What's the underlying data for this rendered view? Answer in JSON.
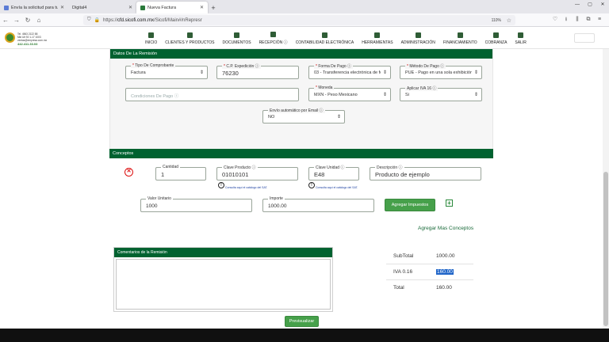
{
  "browser": {
    "tabs": [
      {
        "title": "Envía la solicitud para tu Certif...",
        "active": false
      },
      {
        "title": "Digital4",
        "active": false
      },
      {
        "title": "Nueva Factura",
        "active": true
      }
    ],
    "url_prefix": "https://",
    "url_domain": "cfd.sicofi.com.mx",
    "url_path": "/Sicofi/Main#/nRepresr",
    "zoom": "110%"
  },
  "nav": {
    "items": [
      {
        "label": "INICIO",
        "icon": "home-icon"
      },
      {
        "label": "CLIENTES Y PRODUCTOS",
        "icon": "users-icon"
      },
      {
        "label": "DOCUMENTOS",
        "icon": "folder-icon"
      },
      {
        "label": "RECEPCIÓN ⓘ",
        "icon": "inbox-icon"
      },
      {
        "label": "CONTABILIDAD ELECTRÓNICA",
        "icon": "chart-icon"
      },
      {
        "label": "HERRAMIENTAS",
        "icon": "tools-icon"
      },
      {
        "label": "ADMINISTRACIÓN",
        "icon": "admin-icon"
      },
      {
        "label": "FINANCIAMIENTO",
        "icon": "money-icon"
      },
      {
        "label": "COBRANZA",
        "icon": "cash-icon"
      },
      {
        "label": "SALIR",
        "icon": "logout-icon"
      }
    ],
    "logo_lines": [
      "Tel. 4563 2122 88",
      "Mkt Ult 92 1-17 1003",
      "ventas@empresa.com.mx"
    ],
    "logo_phone": "442.411.33.03"
  },
  "remision": {
    "header": "Datos De La Remisión",
    "tipo_comprobante": {
      "label": "Tipo De Comprobante",
      "value": "Factura"
    },
    "cp_expedicion": {
      "label": "C.P. Expedición ⓘ",
      "value": "76230"
    },
    "forma_pago": {
      "label": "Forma De Pago ⓘ",
      "value": "03 - Transferencia electrónica de fo"
    },
    "metodo_pago": {
      "label": "Método De Pago ⓘ",
      "value": "PUE - Pago en una sola exhibición"
    },
    "condiciones_pago": {
      "placeholder": "Condiciones De Pago ⓘ"
    },
    "moneda": {
      "label": "Moneda",
      "value": "MXN - Peso Mexicano"
    },
    "aplicar_iva": {
      "label": "Aplicar IVA 16 ⓘ",
      "value": "Si"
    },
    "envio_email": {
      "label": "Envío automático por Email ⓘ",
      "value": "NO"
    }
  },
  "conceptos": {
    "header": "Conceptos",
    "cantidad": {
      "label": "Cantidad",
      "value": "1"
    },
    "clave_producto": {
      "label": "Clave Producto ⓘ",
      "value": "01010101"
    },
    "clave_unidad": {
      "label": "Clave Unidad ⓘ",
      "value": "E48"
    },
    "descripcion": {
      "label": "Descripción ⓘ",
      "value": "Producto de ejemplo"
    },
    "valor_unitario": {
      "label": "Valor Unitario",
      "value": "1000"
    },
    "importe": {
      "label": "Importe",
      "value": "1000.00"
    },
    "catalog_note": "Consulta aquí el catálogo del SAT.",
    "agregar_impuestos": "Agregar Impuestos",
    "agregar_mas": "Agregar Mas Conceptos"
  },
  "comentarios": {
    "header": "Comentarios de la Remisión"
  },
  "totales": {
    "subtotal_label": "SubTotal",
    "subtotal_value": "1000.00",
    "iva_label": "IVA 0.16",
    "iva_value": "160.00",
    "total_label": "Total",
    "total_value": "160.00"
  },
  "previsualizar": "Previsualizar"
}
